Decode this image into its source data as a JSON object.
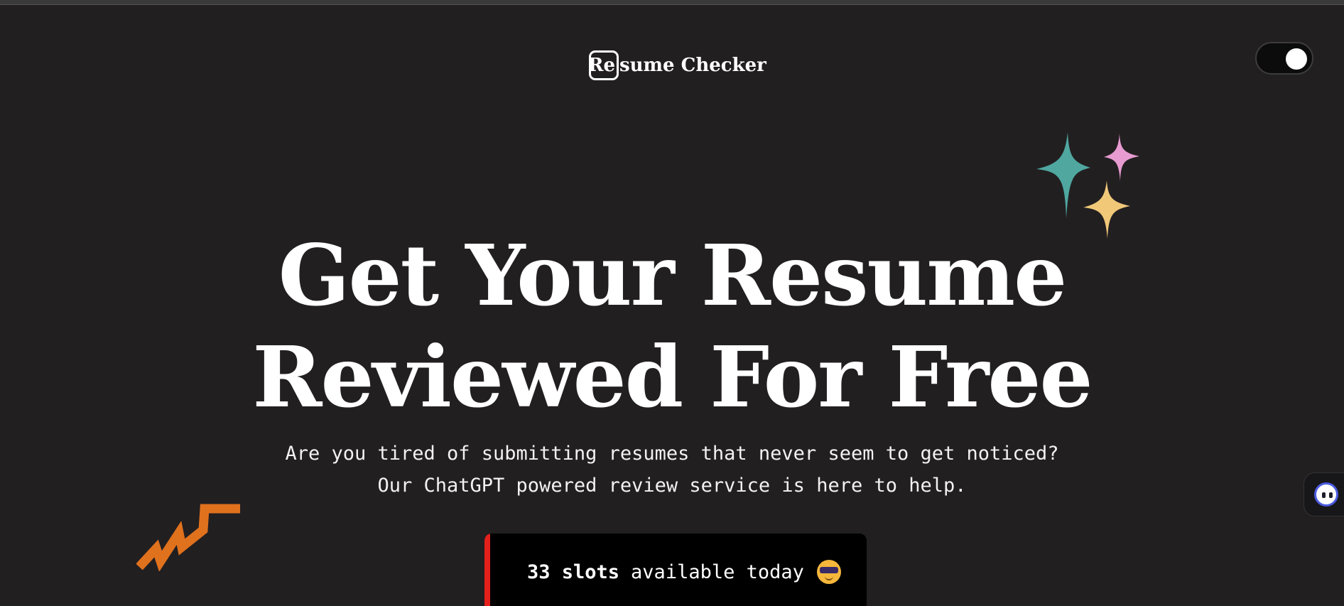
{
  "header": {
    "logo_boxed": "Re",
    "logo_rest": "sume Checker",
    "theme_toggle": "on"
  },
  "hero": {
    "title_line1": "Get Your Resume",
    "title_line2": "Reviewed For Free",
    "subtitle_line1": "Are you tired of submitting resumes that never seem to get noticed?",
    "subtitle_line2": "Our ChatGPT powered review service is here to help."
  },
  "slots": {
    "count_label": "33 slots",
    "suffix": "available today",
    "emoji_icon": "cool-face-emoji"
  },
  "decorations": {
    "sparkle_colors": [
      "#4fa7a0",
      "#e79bd1",
      "#f0c878"
    ],
    "zigzag_color": "#e0711d",
    "accent_bar_color": "#e3201c"
  },
  "side_widget": {
    "icon": "assistant-bot-icon"
  }
}
